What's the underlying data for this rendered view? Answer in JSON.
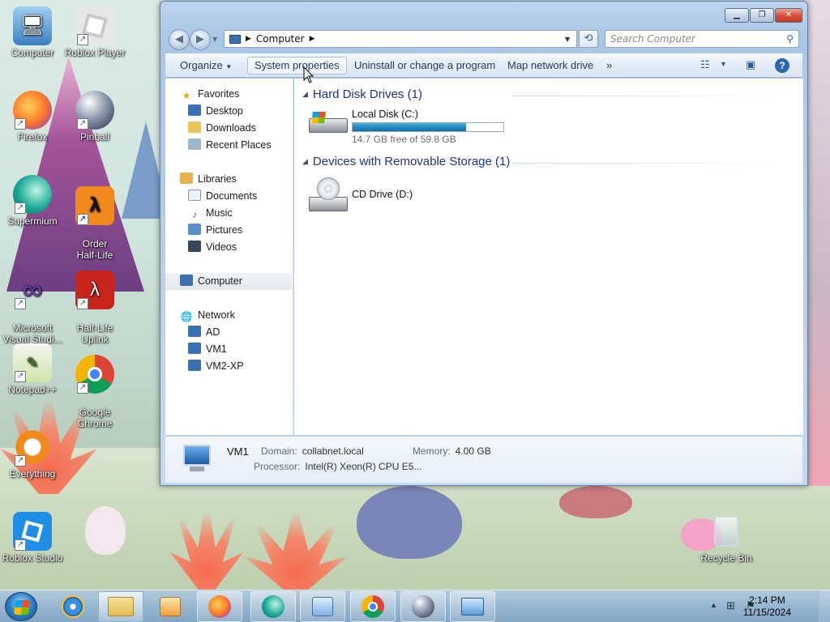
{
  "desktop": {
    "icons": [
      {
        "label": "Computer",
        "icon": "computer-icon"
      },
      {
        "label": "Roblox Player",
        "icon": "roblox-icon"
      },
      {
        "label": "Firefox",
        "icon": "firefox-icon"
      },
      {
        "label": "Pinball",
        "icon": "pinball-icon"
      },
      {
        "label": "Supermium",
        "icon": "supermium-icon"
      },
      {
        "label": "Order\nHalf-Life",
        "icon": "half-life-icon"
      },
      {
        "label": "Microsoft\nVisual Studi...",
        "icon": "visual-studio-icon"
      },
      {
        "label": "Half-Life\nUplink",
        "icon": "half-life-uplink-icon"
      },
      {
        "label": "Notepad++",
        "icon": "notepadpp-icon"
      },
      {
        "label": "Google\nChrome",
        "icon": "chrome-icon"
      },
      {
        "label": "Everything",
        "icon": "everything-icon"
      },
      {
        "label": "Roblox Studio",
        "icon": "roblox-studio-icon"
      },
      {
        "label": "Recycle Bin",
        "icon": "recycle-bin-icon"
      }
    ]
  },
  "window": {
    "address": {
      "path": "Computer"
    },
    "search_placeholder": "Search Computer",
    "commands": [
      "Organize",
      "System properties",
      "Uninstall or change a program",
      "Map network drive",
      "»"
    ],
    "nav": {
      "favorites": "Favorites",
      "favorites_items": [
        "Desktop",
        "Downloads",
        "Recent Places"
      ],
      "libraries": "Libraries",
      "libraries_items": [
        "Documents",
        "Music",
        "Pictures",
        "Videos"
      ],
      "computer": "Computer",
      "network": "Network",
      "network_items": [
        "AD",
        "VM1",
        "VM2-XP"
      ]
    },
    "groups": {
      "hdd": "Hard Disk Drives (1)",
      "removable": "Devices with Removable Storage (1)"
    },
    "drives": {
      "c_label": "Local Disk (C:)",
      "c_free": "14.7 GB free of 59.8 GB",
      "c_used_fraction": 0.754,
      "d_label": "CD Drive (D:)"
    },
    "details": {
      "name": "VM1",
      "domain_key": "Domain:",
      "domain_val": "collabnet.local",
      "memory_key": "Memory:",
      "memory_val": "4.00 GB",
      "processor_key": "Processor:",
      "processor_val": "Intel(R) Xeon(R) CPU E5..."
    }
  },
  "taskbar": {
    "items": [
      "start-button",
      "internet-explorer-icon",
      "windows-explorer-icon",
      "media-player-icon",
      "firefox-icon",
      "supermium-icon",
      "control-panel-icon",
      "chrome-icon",
      "pinball-icon",
      "remote-desktop-icon"
    ],
    "time": "2:14 PM",
    "date": "11/15/2024"
  }
}
